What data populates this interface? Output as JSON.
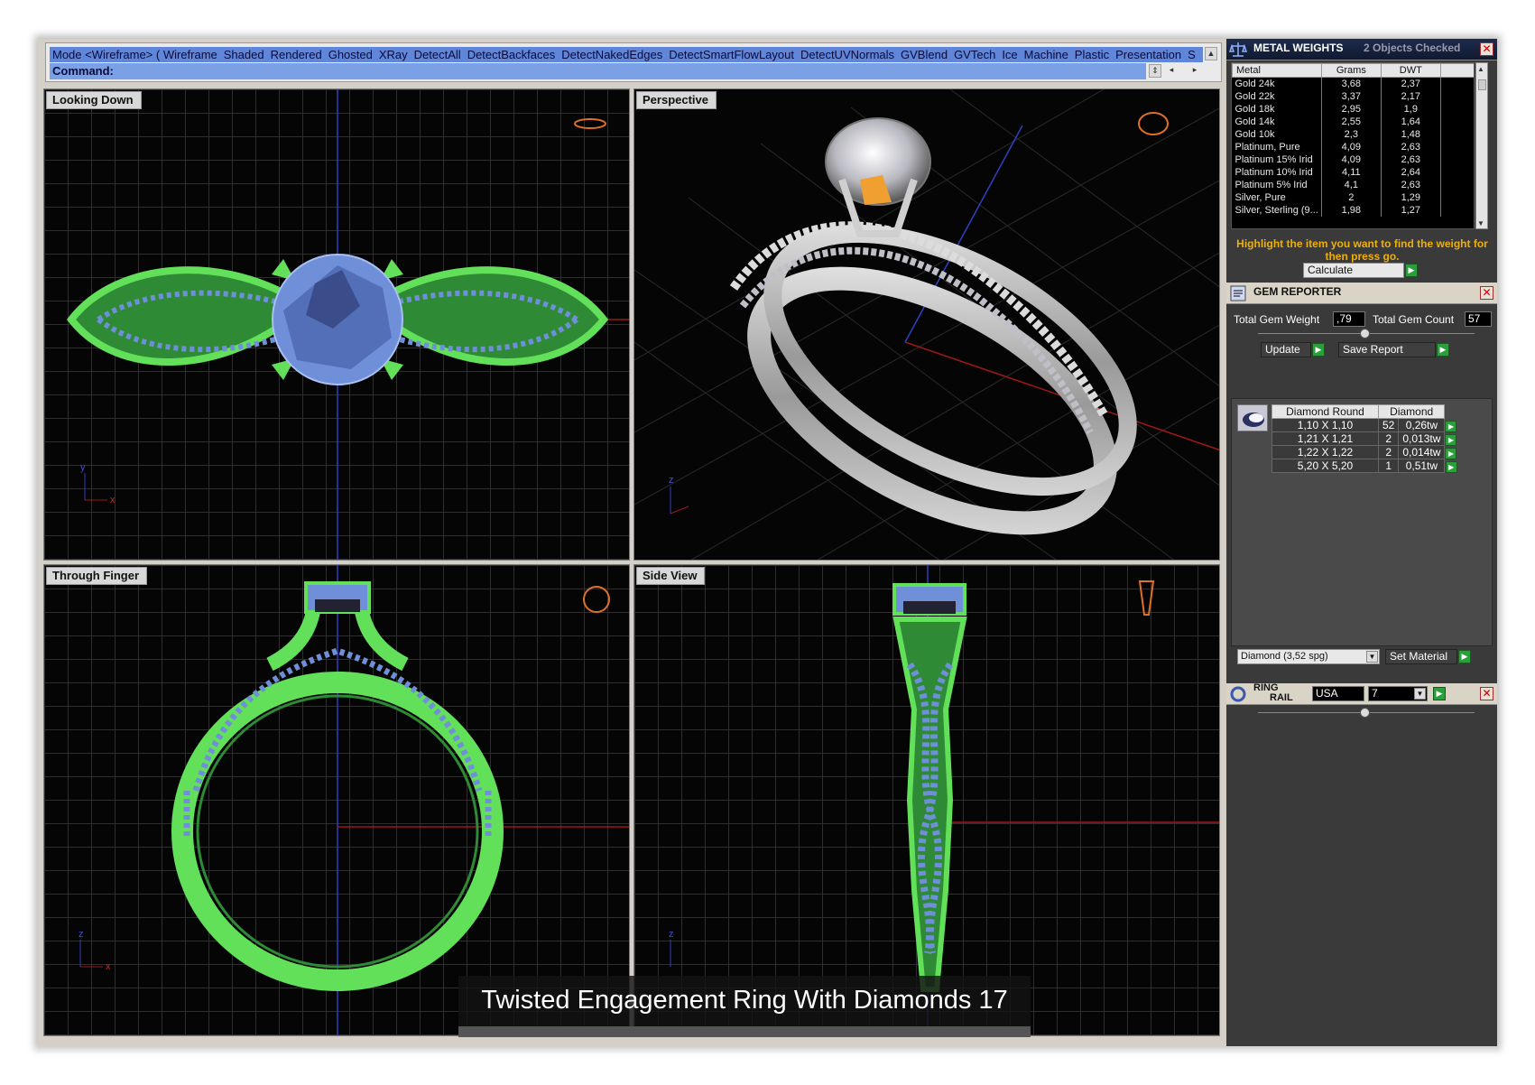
{
  "command_area": {
    "mode_items": [
      "Mode <Wireframe> ( Wireframe",
      "Shaded",
      "Rendered",
      "Ghosted",
      "XRay",
      "DetectAll",
      "DetectBackfaces",
      "DetectNakedEdges",
      "DetectSmartFlowLayout",
      "DetectUVNormals",
      "GVBlend",
      "GVTech",
      "Ice",
      "Machine",
      "Plastic",
      "Presentation",
      "S"
    ],
    "command_label": "Command:",
    "command_value": ""
  },
  "viewports": {
    "top_left": "Looking Down",
    "top_right": "Perspective",
    "bottom_left": "Through Finger",
    "bottom_right": "Side View"
  },
  "axis_labels": {
    "x": "x",
    "y": "y",
    "z": "z"
  },
  "caption": "Twisted Engagement Ring With Diamonds 17",
  "metal_weights": {
    "title": "METAL WEIGHTS",
    "objects_checked": "2 Objects Checked",
    "columns": [
      "Metal",
      "Grams",
      "DWT"
    ],
    "rows": [
      [
        "Gold 24k",
        "3,68",
        "2,37"
      ],
      [
        "Gold 22k",
        "3,37",
        "2,17"
      ],
      [
        "Gold 18k",
        "2,95",
        "1,9"
      ],
      [
        "Gold 14k",
        "2,55",
        "1,64"
      ],
      [
        "Gold 10k",
        "2,3",
        "1,48"
      ],
      [
        "Platinum, Pure",
        "4,09",
        "2,63"
      ],
      [
        "Platinum 15% Irid",
        "4,09",
        "2,63"
      ],
      [
        "Platinum 10% Irid",
        "4,11",
        "2,64"
      ],
      [
        "Platinum 5% Irid",
        "4,1",
        "2,63"
      ],
      [
        "Silver, Pure",
        "2",
        "1,29"
      ],
      [
        "Silver, Sterling (9...",
        "1,98",
        "1,27"
      ]
    ],
    "hint": "Highlight the item you want to find the weight for then press go.",
    "calculate_label": "Calculate"
  },
  "gem_reporter": {
    "title": "GEM REPORTER",
    "total_weight_label": "Total Gem Weight",
    "total_weight_value": ",79",
    "total_count_label": "Total Gem Count",
    "total_count_value": "57",
    "update_label": "Update",
    "save_report_label": "Save Report",
    "columns": [
      "Diamond Round",
      "Diamond"
    ],
    "rows": [
      [
        "1,10 X 1,10",
        "52",
        "0,26tw"
      ],
      [
        "1,21 X 1,21",
        "2",
        "0,013tw"
      ],
      [
        "1,22 X 1,22",
        "2",
        "0,014tw"
      ],
      [
        "5,20 X 5,20",
        "1",
        "0,51tw"
      ]
    ],
    "material_value": "Diamond   (3,52 spg)",
    "set_material_label": "Set Material"
  },
  "ring_rail": {
    "title_line1": "RING",
    "title_line2": "RAIL",
    "region": "USA",
    "size": "7"
  },
  "colors": {
    "wire_green": "#63e05a",
    "gem_blue": "#6f8fd8",
    "accent_green": "#29a03a",
    "hint_orange": "#f0b000"
  }
}
